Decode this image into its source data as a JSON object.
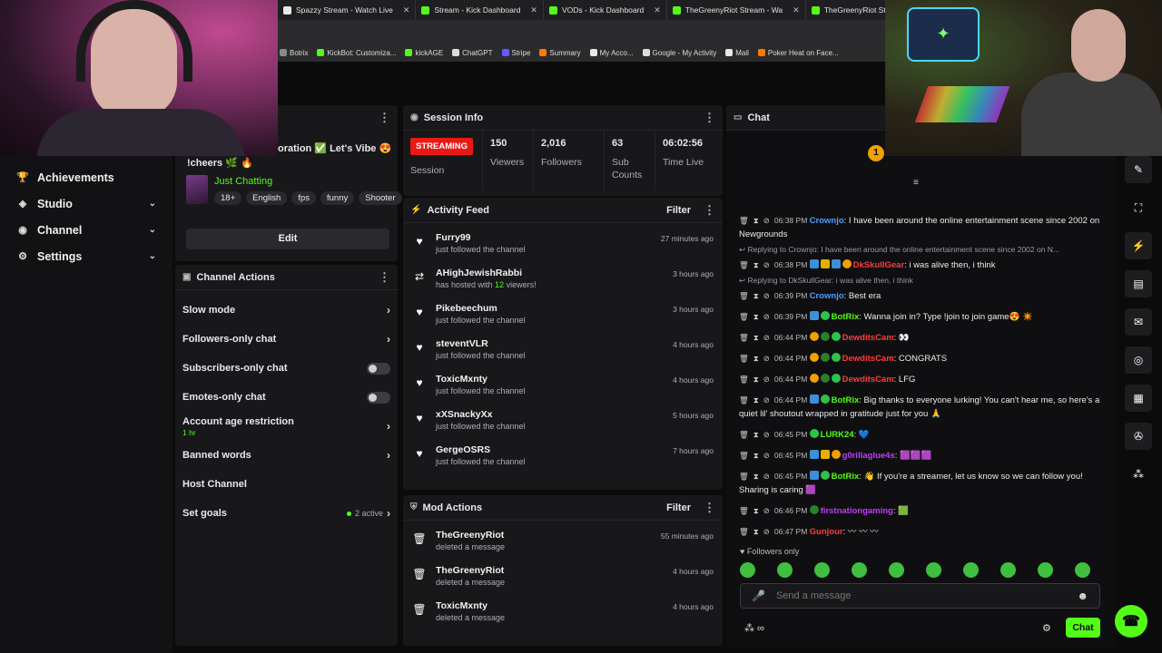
{
  "browser": {
    "tabs": [
      {
        "label": "Spazzy Stream - Watch Live",
        "color": "#e8e8e8"
      },
      {
        "label": "Stream - Kick Dashboard",
        "color": "#53fc18"
      },
      {
        "label": "VODs - Kick Dashboard",
        "color": "#53fc18"
      },
      {
        "label": "TheGreenyRiot Stream - Wa",
        "color": "#53fc18"
      },
      {
        "label": "TheGreenyRiot Strean",
        "color": "#53fc18"
      }
    ],
    "bookmarks": [
      {
        "label": "Botrix",
        "color": "#888"
      },
      {
        "label": "KickBot: Customiza...",
        "color": "#53fc18"
      },
      {
        "label": "kickAGE",
        "color": "#53fc18"
      },
      {
        "label": "ChatGPT",
        "color": "#ddd"
      },
      {
        "label": "Stripe",
        "color": "#635bff"
      },
      {
        "label": "Summary",
        "color": "#ff7a00"
      },
      {
        "label": "My Acco...",
        "color": "#e8e8e8"
      },
      {
        "label": "Google - My Activity",
        "color": "#ddd"
      },
      {
        "label": "Mail",
        "color": "#e8e8e8"
      },
      {
        "label": "Poker Heat on Face...",
        "color": "#ff7a00"
      }
    ]
  },
  "sidebar": {
    "items": [
      {
        "label": "Achievements",
        "icon": "trophy-icon",
        "chevron": false
      },
      {
        "label": "Studio",
        "icon": "studio-icon",
        "chevron": true
      },
      {
        "label": "Channel",
        "icon": "channel-icon",
        "chevron": true
      },
      {
        "label": "Settings",
        "icon": "gear-icon",
        "chevron": true
      }
    ]
  },
  "stream_info": {
    "title": "oration ✅ Let's Vibe 😍",
    "cheers": "!cheers 🌿 🔥",
    "category": "Just Chatting",
    "tags": [
      "18+",
      "English",
      "fps",
      "funny",
      "Shooter"
    ],
    "edit_label": "Edit"
  },
  "channel_actions": {
    "title": "Channel Actions",
    "rows": [
      {
        "label": "Slow mode",
        "control": "chevron"
      },
      {
        "label": "Followers-only chat",
        "control": "chevron"
      },
      {
        "label": "Subscribers-only chat",
        "control": "toggle"
      },
      {
        "label": "Emotes-only chat",
        "control": "toggle"
      },
      {
        "label": "Account age restriction",
        "sub": "1 hr",
        "control": "chevron"
      },
      {
        "label": "Banned words",
        "control": "chevron"
      },
      {
        "label": "Host Channel",
        "control": "none"
      },
      {
        "label": "Set goals",
        "control": "active",
        "active_text": "2 active"
      }
    ]
  },
  "session_info": {
    "title": "Session Info",
    "status": "STREAMING",
    "status_label": "Session",
    "stats": [
      {
        "value": "150",
        "label": "Viewers"
      },
      {
        "value": "2,016",
        "label": "Followers"
      },
      {
        "value": "63",
        "label": "Sub Counts"
      },
      {
        "value": "06:02:56",
        "label": "Time Live"
      }
    ]
  },
  "activity_feed": {
    "title": "Activity Feed",
    "filter_label": "Filter",
    "items": [
      {
        "name": "Furry99",
        "desc": "just followed the channel",
        "time": "27 minutes ago",
        "icon": "heart-icon"
      },
      {
        "name": "AHighJewishRabbi",
        "desc_pre": "has hosted with ",
        "desc_hi": "12",
        "desc_post": " viewers!",
        "time": "3 hours ago",
        "icon": "host-icon"
      },
      {
        "name": "Pikebeechum",
        "desc": "just followed the channel",
        "time": "3 hours ago",
        "icon": "heart-icon"
      },
      {
        "name": "steventVLR",
        "desc": "just followed the channel",
        "time": "4 hours ago",
        "icon": "heart-icon"
      },
      {
        "name": "ToxicMxnty",
        "desc": "just followed the channel",
        "time": "4 hours ago",
        "icon": "heart-icon"
      },
      {
        "name": "xXSnackyXx",
        "desc": "just followed the channel",
        "time": "5 hours ago",
        "icon": "heart-icon"
      },
      {
        "name": "GergeOSRS",
        "desc": "just followed the channel",
        "time": "7 hours ago",
        "icon": "heart-icon"
      }
    ]
  },
  "mod_actions": {
    "title": "Mod Actions",
    "filter_label": "Filter",
    "items": [
      {
        "name": "TheGreenyRiot",
        "desc": "deleted a message",
        "time": "55 minutes ago"
      },
      {
        "name": "TheGreenyRiot",
        "desc": "deleted a message",
        "time": "4 hours ago"
      },
      {
        "name": "ToxicMxnty",
        "desc": "deleted a message",
        "time": "4 hours ago"
      }
    ]
  },
  "chat": {
    "title": "Chat",
    "messages": [
      {
        "time": "06:38 PM",
        "user": "Crownjo",
        "color": "#4f9fff",
        "badges": [],
        "text": ": I have been around the online entertainment scene since 2002 on Newgrounds"
      },
      {
        "reply": "Replying to Crownjo: I have been around the online entertainment scene since 2002 on N..."
      },
      {
        "time": "06:38 PM",
        "user": "DkSkullGear",
        "color": "#ff3b3b",
        "badges": [
          "blue",
          "crown",
          "blue",
          "gold"
        ],
        "text": ": i was alive then, i think"
      },
      {
        "reply": "Replying to DkSkullGear: i was alive then, i think"
      },
      {
        "time": "06:39 PM",
        "user": "Crownjo",
        "color": "#4f9fff",
        "badges": [],
        "text": ": Best era"
      },
      {
        "time": "06:39 PM",
        "user": "BotRix",
        "color": "#53fc18",
        "badges": [
          "blue",
          "green"
        ],
        "text": ": Wanna join in? Type !join to join game😍 ✴️"
      },
      {
        "time": "06:44 PM",
        "user": "DewditsCam",
        "color": "#ff3b3b",
        "badges": [
          "gold",
          "leaf",
          "green"
        ],
        "text": ": 👀"
      },
      {
        "time": "06:44 PM",
        "user": "DewditsCam",
        "color": "#ff3b3b",
        "badges": [
          "gold",
          "leaf",
          "green"
        ],
        "text": ": CONGRATS"
      },
      {
        "time": "06:44 PM",
        "user": "DewditsCam",
        "color": "#ff3b3b",
        "badges": [
          "gold",
          "leaf",
          "green"
        ],
        "text": ": LFG"
      },
      {
        "time": "06:44 PM",
        "user": "BotRix",
        "color": "#53fc18",
        "badges": [
          "blue",
          "green"
        ],
        "text": ": Big thanks to everyone lurking! You can't hear me, so here's a quiet lil' shoutout wrapped in gratitude just for you 🙏"
      },
      {
        "time": "06:45 PM",
        "user": "LURK24",
        "color": "#53fc18",
        "badges": [
          "green"
        ],
        "text": ": 💙"
      },
      {
        "time": "06:45 PM",
        "user": "g0rillaglue4s",
        "color": "#c03bff",
        "badges": [
          "blue",
          "crown",
          "gold"
        ],
        "text": ": 🟪🟪🟪"
      },
      {
        "time": "06:45 PM",
        "user": "BotRix",
        "color": "#53fc18",
        "badges": [
          "blue",
          "green"
        ],
        "text": ": 👋 If you're a streamer, let us know so we can follow you! Sharing is caring 🟪"
      },
      {
        "time": "06:46 PM",
        "user": "firstnationgaming",
        "color": "#c03bff",
        "badges": [
          "leaf"
        ],
        "text": ": 🟩"
      },
      {
        "time": "06:47 PM",
        "user": "Gunjour",
        "color": "#ff3b3b",
        "badges": [],
        "text": ": 〰 〰 〰"
      }
    ],
    "followers_only": "Followers only",
    "placeholder": "Send a message",
    "send_label": "Chat"
  }
}
